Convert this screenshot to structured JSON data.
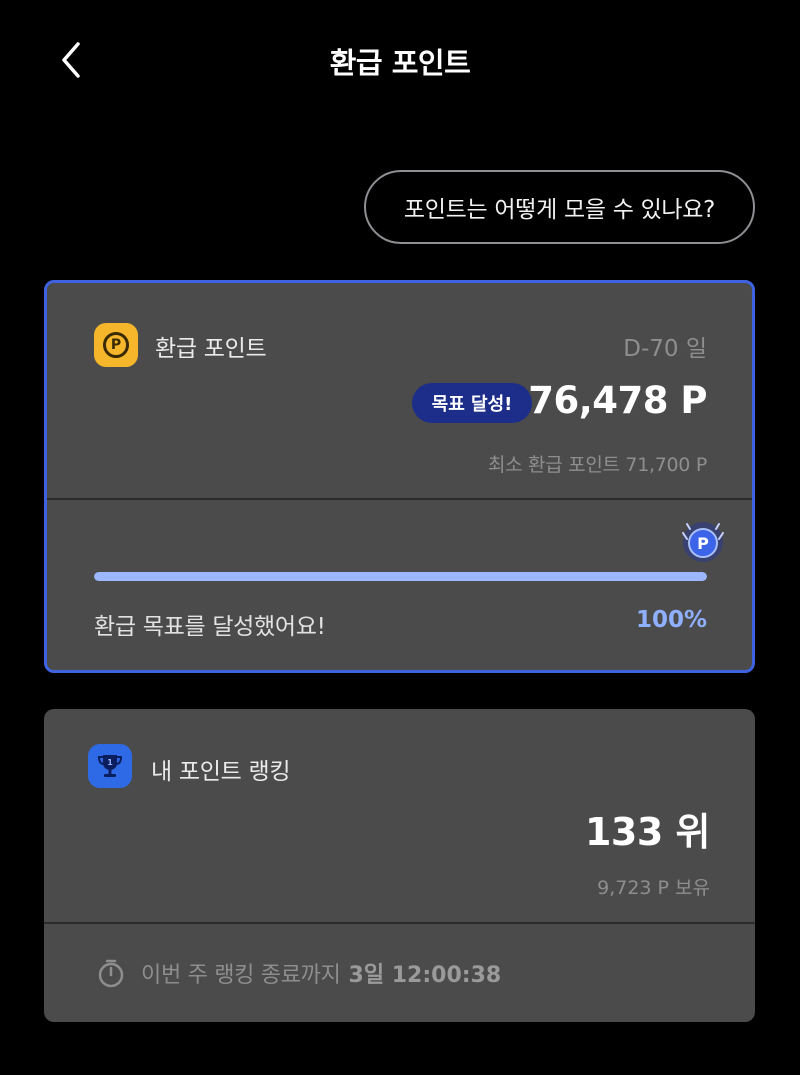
{
  "header": {
    "title": "환급 포인트",
    "back_icon": "chevron-left-icon"
  },
  "faq": {
    "label": "포인트는 어떻게 모을 수 있나요?"
  },
  "refund_card": {
    "icon": "points-coin-icon",
    "icon_letter": "P",
    "label": "환급 포인트",
    "dday": "D-70 일",
    "badge": "목표 달성!",
    "points": "76,478 P",
    "min_points": "최소 환급 포인트 71,700 P",
    "progress_percent": 100,
    "progress_message": "환급 목표를 달성했어요!",
    "progress_label": "100%",
    "coin_marker_icon": "p-coin-badge-icon",
    "colors": {
      "border": "#3f63e0",
      "badge_bg": "#1d2e8a",
      "progress_fill": "#9db7ff",
      "percent_text": "#8fb0ff",
      "icon_bg": "#f5b62b"
    }
  },
  "ranking_card": {
    "icon": "trophy-icon",
    "label": "내 포인트 랭킹",
    "rank": "133 위",
    "points_held": "9,723 P 보유",
    "timer_icon": "stopwatch-icon",
    "timer_label": "이번 주 랭킹 종료까지",
    "timer_value": "3일 12:00:38",
    "colors": {
      "icon_bg": "#2f6ae6"
    }
  }
}
